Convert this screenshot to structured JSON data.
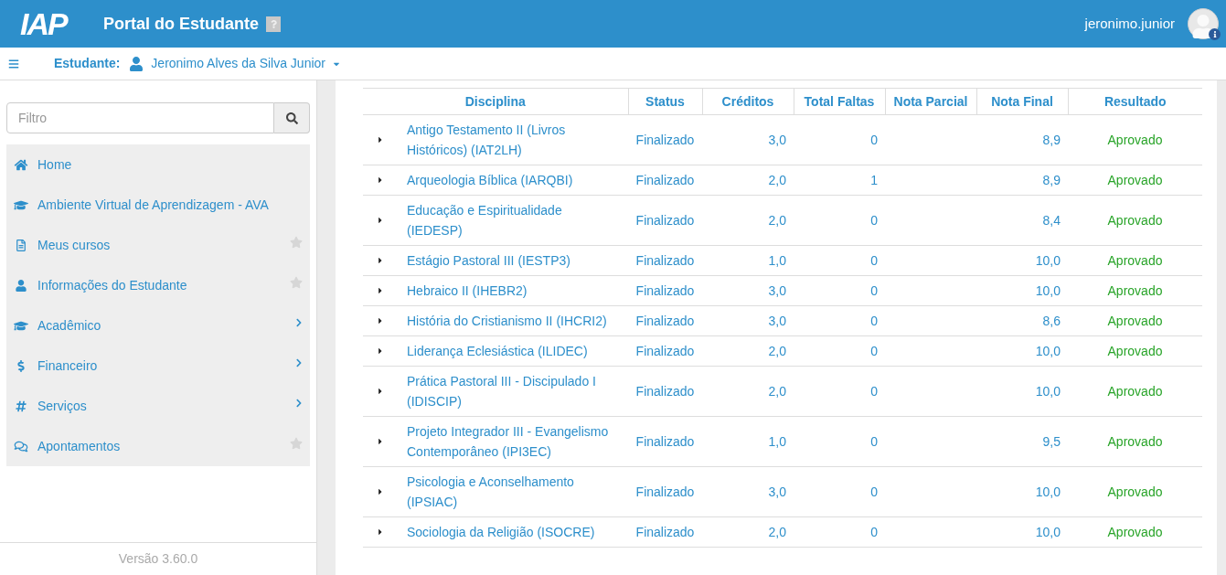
{
  "header": {
    "logo_text": "IAP",
    "title": "Portal do Estudante",
    "username": "jeronimo.junior"
  },
  "subheader": {
    "label": "Estudante:",
    "student_name": "Jeronimo Alves da Silva Junior"
  },
  "sidebar": {
    "filter": {
      "placeholder": "Filtro"
    },
    "items": [
      {
        "label": "Home",
        "kind": "link"
      },
      {
        "label": "Ambiente Virtual de Aprendizagem - AVA",
        "kind": "link"
      },
      {
        "label": "Meus cursos",
        "kind": "favorite"
      },
      {
        "label": "Informações do Estudante",
        "kind": "favorite"
      },
      {
        "label": "Acadêmico",
        "kind": "submenu"
      },
      {
        "label": "Financeiro",
        "kind": "submenu"
      },
      {
        "label": "Serviços",
        "kind": "submenu"
      },
      {
        "label": "Apontamentos",
        "kind": "favorite"
      }
    ],
    "version": "Versão 3.60.0"
  },
  "table": {
    "columns": [
      "Disciplina",
      "Status",
      "Créditos",
      "Total Faltas",
      "Nota Parcial",
      "Nota Final",
      "Resultado"
    ],
    "rows": [
      {
        "disciplina": "Antigo Testamento II (Livros Históricos) (IAT2LH)",
        "status": "Finalizado",
        "creditos": "3,0",
        "faltas": "0",
        "nota_final": "8,9",
        "resultado": "Aprovado"
      },
      {
        "disciplina": "Arqueologia Bíblica (IARQBI)",
        "status": "Finalizado",
        "creditos": "2,0",
        "faltas": "1",
        "nota_final": "8,9",
        "resultado": "Aprovado"
      },
      {
        "disciplina": "Educação e Espiritualidade (IEDESP)",
        "status": "Finalizado",
        "creditos": "2,0",
        "faltas": "0",
        "nota_final": "8,4",
        "resultado": "Aprovado"
      },
      {
        "disciplina": "Estágio Pastoral III (IESTP3)",
        "status": "Finalizado",
        "creditos": "1,0",
        "faltas": "0",
        "nota_final": "10,0",
        "resultado": "Aprovado"
      },
      {
        "disciplina": "Hebraico II (IHEBR2)",
        "status": "Finalizado",
        "creditos": "3,0",
        "faltas": "0",
        "nota_final": "10,0",
        "resultado": "Aprovado"
      },
      {
        "disciplina": "História do Cristianismo II (IHCRI2)",
        "status": "Finalizado",
        "creditos": "3,0",
        "faltas": "0",
        "nota_final": "8,6",
        "resultado": "Aprovado"
      },
      {
        "disciplina": "Liderança Eclesiástica (ILIDEC)",
        "status": "Finalizado",
        "creditos": "2,0",
        "faltas": "0",
        "nota_final": "10,0",
        "resultado": "Aprovado"
      },
      {
        "disciplina": "Prática Pastoral III - Discipulado I (IDISCIP)",
        "status": "Finalizado",
        "creditos": "2,0",
        "faltas": "0",
        "nota_final": "10,0",
        "resultado": "Aprovado"
      },
      {
        "disciplina": "Projeto Integrador III - Evangelismo Contemporâneo (IPI3EC)",
        "status": "Finalizado",
        "creditos": "1,0",
        "faltas": "0",
        "nota_final": "9,5",
        "resultado": "Aprovado"
      },
      {
        "disciplina": "Psicologia e Aconselhamento (IPSIAC)",
        "status": "Finalizado",
        "creditos": "3,0",
        "faltas": "0",
        "nota_final": "10,0",
        "resultado": "Aprovado"
      },
      {
        "disciplina": "Sociologia da Religião (ISOCRE)",
        "status": "Finalizado",
        "creditos": "2,0",
        "faltas": "0",
        "nota_final": "10,0",
        "resultado": "Aprovado"
      }
    ]
  }
}
